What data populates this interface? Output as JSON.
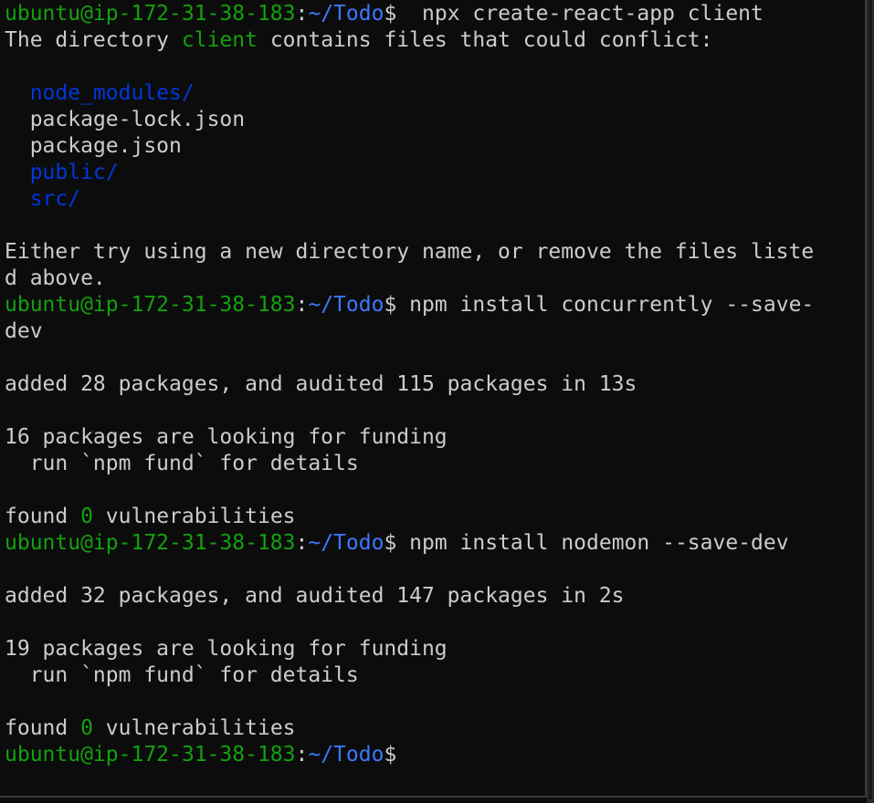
{
  "terminal": {
    "colors": {
      "background": "#0c0c0c",
      "text": "#cccccc",
      "prompt_user": "#13a10e",
      "prompt_path": "#3b78ff",
      "directory": "#0037da",
      "highlight_green": "#13a10e"
    },
    "prompt": {
      "user_host": "ubuntu@ip-172-31-38-183",
      "colon": ":",
      "path": "~/Todo",
      "dollar": "$"
    },
    "cmd1": "  npx create-react-app client",
    "conflict": {
      "pre": "The directory ",
      "dir": "client",
      "post": " contains files that could conflict:"
    },
    "files": [
      {
        "name": "node_modules/",
        "type": "dir"
      },
      {
        "name": "package-lock.json",
        "type": "file"
      },
      {
        "name": "package.json",
        "type": "file"
      },
      {
        "name": "public/",
        "type": "dir"
      },
      {
        "name": "src/",
        "type": "dir"
      }
    ],
    "either_line1": "Either try using a new directory name, or remove the files liste",
    "either_line2": "d above.",
    "cmd2_line1": " npm install concurrently --save-",
    "cmd2_line2": "dev",
    "added1": "added 28 packages, and audited 115 packages in 13s",
    "funding1": "16 packages are looking for funding",
    "fund_hint1": "  run `npm fund` for details",
    "found1_pre": "found ",
    "found1_count": "0",
    "found1_post": " vulnerabilities",
    "cmd3": " npm install nodemon --save-dev",
    "added2": "added 32 packages, and audited 147 packages in 2s",
    "funding2": "19 packages are looking for funding",
    "fund_hint2": "  run `npm fund` for details",
    "found2_pre": "found ",
    "found2_count": "0",
    "found2_post": " vulnerabilities"
  }
}
